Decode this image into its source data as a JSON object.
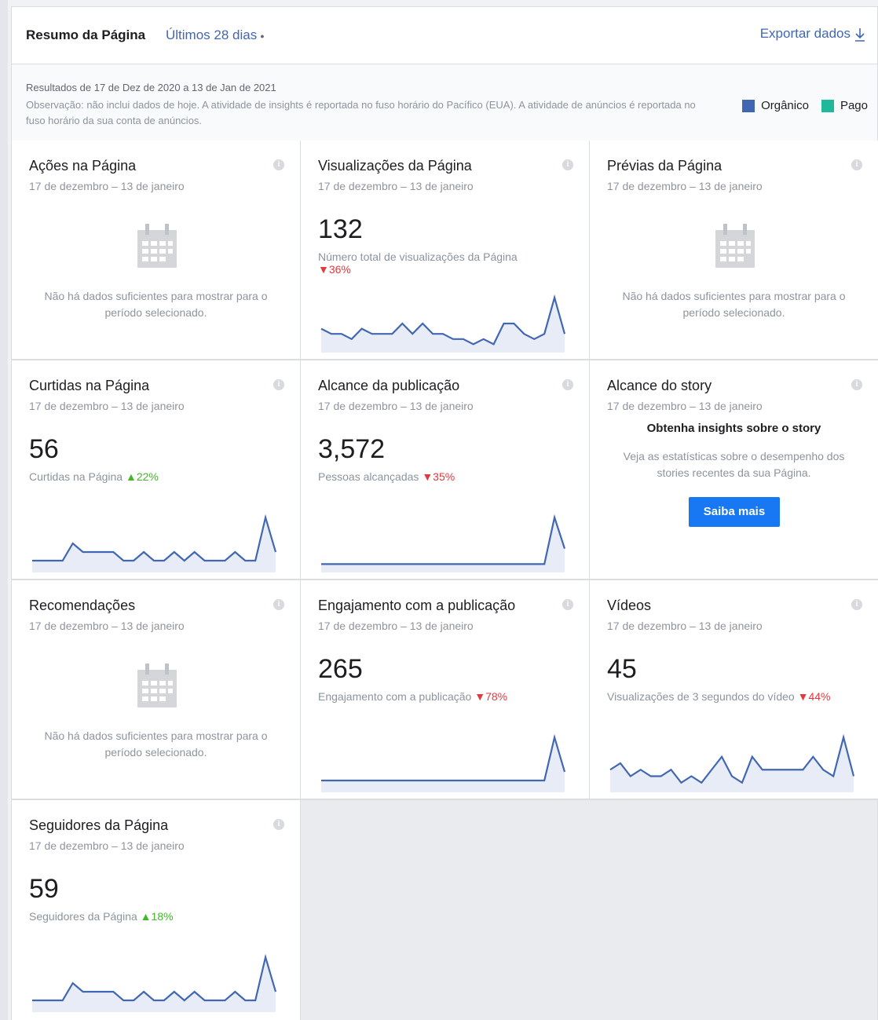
{
  "header": {
    "title": "Resumo da Página",
    "period": "Últimos 28 dias",
    "export_label": "Exportar dados"
  },
  "note": {
    "range": "Resultados de 17 de Dez de 2020 a 13 de Jan de 2021",
    "observation": "Observação: não inclui dados de hoje. A atividade de insights é reportada no fuso horário do Pacífico (EUA). A atividade de anúncios é reportada no fuso horário da sua conta de anúncios."
  },
  "legend": {
    "organic": "Orgânico",
    "paid": "Pago",
    "organic_color": "#4267b2",
    "paid_color": "#20b89a"
  },
  "date_range": "17 de dezembro – 13 de janeiro",
  "empty_text": "Não há dados suficientes para mostrar para o período selecionado.",
  "cards": {
    "acoes": {
      "title": "Ações na Página"
    },
    "visualizacoes": {
      "title": "Visualizações da Página",
      "value": "132",
      "subtitle": "Número total de visualizações da Página",
      "change": "36%",
      "direction": "down"
    },
    "previas": {
      "title": "Prévias da Página"
    },
    "curtidas": {
      "title": "Curtidas na Página",
      "value": "56",
      "subtitle": "Curtidas na Página",
      "change": "22%",
      "direction": "up"
    },
    "alcance": {
      "title": "Alcance da publicação",
      "value": "3,572",
      "subtitle": "Pessoas alcançadas",
      "change": "35%",
      "direction": "down"
    },
    "story": {
      "title": "Alcance do story",
      "heading": "Obtenha insights sobre o story",
      "text": "Veja as estatísticas sobre o desempenho dos stories recentes da sua Página.",
      "button": "Saiba mais"
    },
    "recomendacoes": {
      "title": "Recomendações"
    },
    "engajamento": {
      "title": "Engajamento com a publicação",
      "value": "265",
      "subtitle": "Engajamento com a publicação",
      "change": "78%",
      "direction": "down"
    },
    "videos": {
      "title": "Vídeos",
      "value": "45",
      "subtitle": "Visualizações de 3 segundos do vídeo",
      "change": "44%",
      "direction": "down"
    },
    "seguidores": {
      "title": "Seguidores da Página",
      "value": "59",
      "subtitle": "Seguidores da Página",
      "change": "18%",
      "direction": "up"
    }
  },
  "sparklines": {
    "visualizacoes": [
      4,
      3,
      3,
      2,
      4,
      3,
      3,
      3,
      5,
      3,
      5,
      3,
      3,
      2,
      2,
      1,
      2,
      1,
      5,
      5,
      3,
      2,
      3,
      10,
      3
    ],
    "curtidas": [
      1,
      1,
      1,
      1,
      3,
      2,
      2,
      2,
      2,
      1,
      1,
      2,
      1,
      1,
      2,
      1,
      2,
      1,
      1,
      1,
      2,
      1,
      1,
      6,
      2
    ],
    "alcance": [
      1,
      1,
      1,
      1,
      1,
      1,
      1,
      1,
      1,
      1,
      1,
      1,
      1,
      1,
      1,
      1,
      1,
      1,
      1,
      1,
      1,
      1,
      1,
      10,
      4
    ],
    "engajamento": [
      1,
      1,
      1,
      1,
      1,
      1,
      1,
      1,
      1,
      1,
      1,
      1,
      1,
      1,
      1,
      1,
      1,
      1,
      1,
      1,
      1,
      1,
      1,
      6,
      2
    ],
    "videos": [
      3,
      4,
      2,
      3,
      2,
      2,
      3,
      1,
      2,
      1,
      3,
      5,
      2,
      1,
      5,
      3,
      3,
      3,
      3,
      3,
      5,
      3,
      2,
      8,
      2
    ],
    "seguidores": [
      1,
      1,
      1,
      1,
      3,
      2,
      2,
      2,
      2,
      1,
      1,
      2,
      1,
      1,
      2,
      1,
      2,
      1,
      1,
      1,
      2,
      1,
      1,
      6,
      2
    ]
  }
}
